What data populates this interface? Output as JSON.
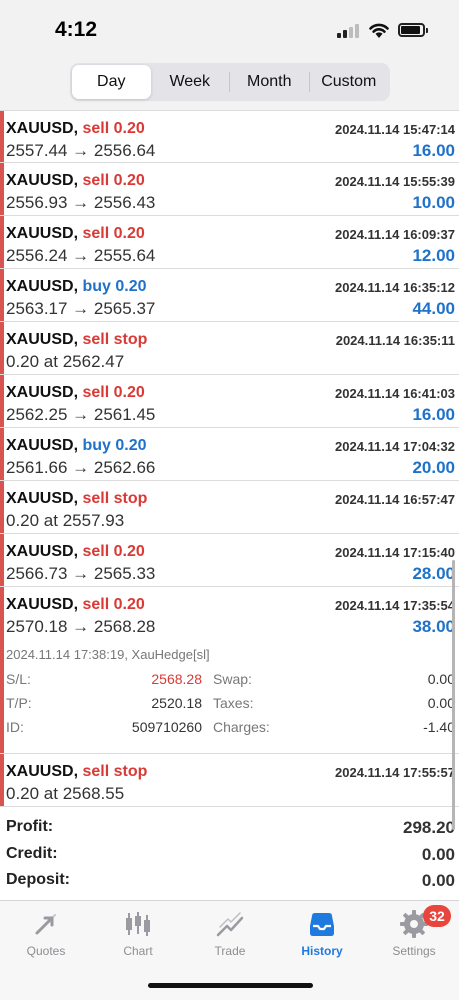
{
  "status_bar": {
    "time": "4:12"
  },
  "segments": [
    "Day",
    "Week",
    "Month",
    "Custom"
  ],
  "segments_active": "Day",
  "deals": [
    {
      "symbol": "XAUUSD,",
      "side": "sell 0.20",
      "side_type": "sell",
      "time": "2024.11.14 15:47:14",
      "prices": "2557.44 → 2556.64",
      "profit": "16.00"
    },
    {
      "symbol": "XAUUSD,",
      "side": "sell 0.20",
      "side_type": "sell",
      "time": "2024.11.14 15:55:39",
      "prices": "2556.93 → 2556.43",
      "profit": "10.00"
    },
    {
      "symbol": "XAUUSD,",
      "side": "sell 0.20",
      "side_type": "sell",
      "time": "2024.11.14 16:09:37",
      "prices": "2556.24 → 2555.64",
      "profit": "12.00"
    },
    {
      "symbol": "XAUUSD,",
      "side": "buy 0.20",
      "side_type": "buy",
      "time": "2024.11.14 16:35:12",
      "prices": "2563.17 → 2565.37",
      "profit": "44.00"
    },
    {
      "symbol": "XAUUSD,",
      "side": "sell stop",
      "side_type": "sell",
      "time": "2024.11.14 16:35:11",
      "prices": "0.20 at 2562.47",
      "profit": ""
    },
    {
      "symbol": "XAUUSD,",
      "side": "sell 0.20",
      "side_type": "sell",
      "time": "2024.11.14 16:41:03",
      "prices": "2562.25 → 2561.45",
      "profit": "16.00"
    },
    {
      "symbol": "XAUUSD,",
      "side": "buy 0.20",
      "side_type": "buy",
      "time": "2024.11.14 17:04:32",
      "prices": "2561.66 → 2562.66",
      "profit": "20.00"
    },
    {
      "symbol": "XAUUSD,",
      "side": "sell stop",
      "side_type": "sell",
      "time": "2024.11.14 16:57:47",
      "prices": "0.20 at 2557.93",
      "profit": ""
    },
    {
      "symbol": "XAUUSD,",
      "side": "sell 0.20",
      "side_type": "sell",
      "time": "2024.11.14 17:15:40",
      "prices": "2566.73 → 2565.33",
      "profit": "28.00"
    },
    {
      "symbol": "XAUUSD,",
      "side": "sell 0.20",
      "side_type": "sell",
      "time": "2024.11.14 17:35:54",
      "prices": "2570.18 → 2568.28",
      "profit": "38.00"
    }
  ],
  "detail": {
    "meta": "2024.11.14 17:38:19, XauHedge[sl]",
    "sl_label": "S/L:",
    "sl_value": "2568.28",
    "tp_label": "T/P:",
    "tp_value": "2520.18",
    "id_label": "ID:",
    "id_value": "509710260",
    "swap_label": "Swap:",
    "swap_value": "0.00",
    "taxes_label": "Taxes:",
    "taxes_value": "0.00",
    "charges_label": "Charges:",
    "charges_value": "-1.40"
  },
  "last_order": {
    "symbol": "XAUUSD,",
    "side": "sell stop",
    "time": "2024.11.14 17:55:57",
    "prices": "0.20 at 2568.55"
  },
  "summary": [
    {
      "label": "Profit:",
      "value": "298.20"
    },
    {
      "label": "Credit:",
      "value": "0.00"
    },
    {
      "label": "Deposit:",
      "value": "0.00"
    }
  ],
  "tabs": [
    {
      "label": "Quotes",
      "icon": "quotes-icon"
    },
    {
      "label": "Chart",
      "icon": "chart-icon"
    },
    {
      "label": "Trade",
      "icon": "trade-icon"
    },
    {
      "label": "History",
      "icon": "history-icon"
    },
    {
      "label": "Settings",
      "icon": "gear-icon"
    }
  ],
  "active_tab": "History",
  "settings_badge": "32",
  "colors": {
    "sell": "#d93a35",
    "buy": "#1f72c9",
    "accent": "#1f7ae0",
    "badge": "#e8453c"
  }
}
